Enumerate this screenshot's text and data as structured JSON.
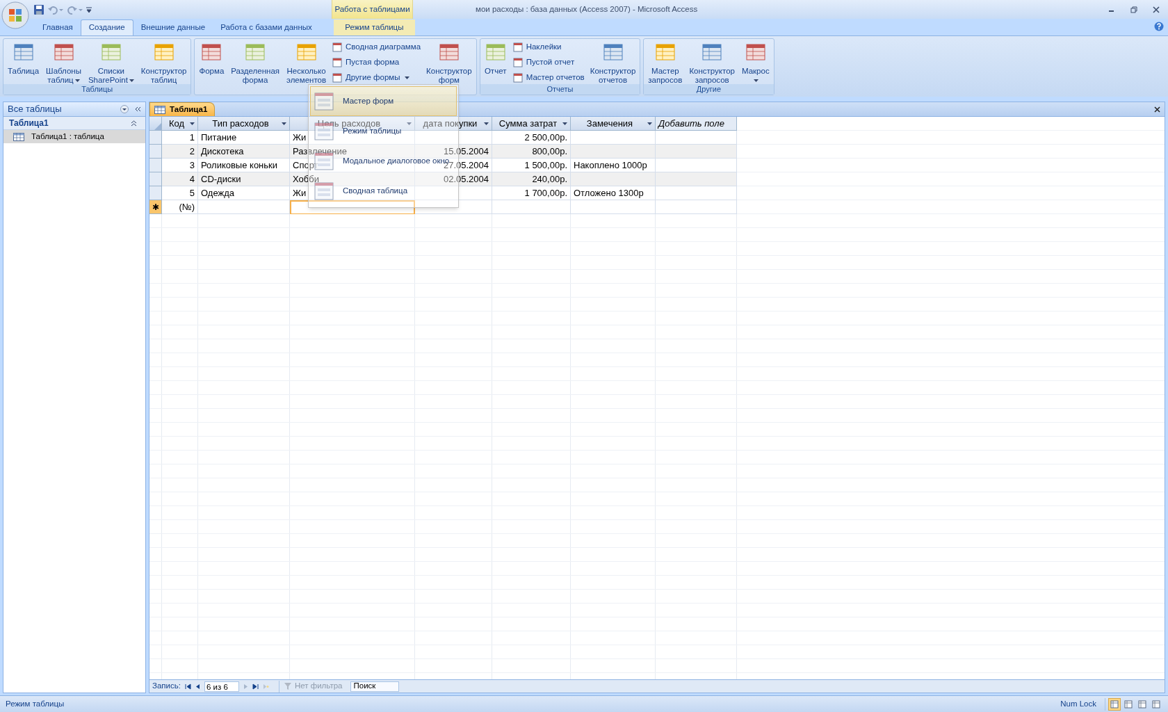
{
  "window": {
    "title": "мои расходы : база данных (Access 2007) - Microsoft Access"
  },
  "contextual_group": {
    "label": "Работа с таблицами"
  },
  "tabs": [
    {
      "label": "Главная",
      "selected": false,
      "contextual": false
    },
    {
      "label": "Создание",
      "selected": true,
      "contextual": false
    },
    {
      "label": "Внешние данные",
      "selected": false,
      "contextual": false
    },
    {
      "label": "Работа с базами данных",
      "selected": false,
      "contextual": false
    },
    {
      "label": "Режим таблицы",
      "selected": false,
      "contextual": true
    }
  ],
  "ribbon_groups": [
    {
      "label": "Таблицы",
      "items": [
        {
          "kind": "large",
          "lines": [
            "Таблица"
          ],
          "dropdown": false
        },
        {
          "kind": "large",
          "lines": [
            "Шаблоны",
            "таблиц"
          ],
          "dropdown": true
        },
        {
          "kind": "large",
          "lines": [
            "Списки",
            "SharePoint"
          ],
          "dropdown": true
        },
        {
          "kind": "large",
          "lines": [
            "Конструктор",
            "таблиц"
          ],
          "dropdown": false
        }
      ]
    },
    {
      "items": [
        {
          "kind": "large",
          "lines": [
            "Форма"
          ],
          "dropdown": false
        },
        {
          "kind": "large",
          "lines": [
            "Разделенная",
            "форма"
          ],
          "dropdown": false
        },
        {
          "kind": "large",
          "lines": [
            "Несколько",
            "элементов"
          ],
          "dropdown": false
        },
        {
          "kind": "small",
          "entries": [
            {
              "label": "Сводная диаграмма",
              "dropdown": false
            },
            {
              "label": "Пустая форма",
              "dropdown": false
            },
            {
              "label": "Другие формы",
              "dropdown": true
            }
          ]
        },
        {
          "kind": "large",
          "lines": [
            "Конструктор",
            "форм"
          ],
          "dropdown": false
        }
      ]
    },
    {
      "label": "Отчеты",
      "items": [
        {
          "kind": "large",
          "lines": [
            "Отчет"
          ],
          "dropdown": false
        },
        {
          "kind": "small",
          "entries": [
            {
              "label": "Наклейки",
              "dropdown": false
            },
            {
              "label": "Пустой отчет",
              "dropdown": false
            },
            {
              "label": "Мастер отчетов",
              "dropdown": false
            }
          ]
        },
        {
          "kind": "large",
          "lines": [
            "Конструктор",
            "отчетов"
          ],
          "dropdown": false
        }
      ]
    },
    {
      "label": "Другие",
      "items": [
        {
          "kind": "large",
          "lines": [
            "Мастер",
            "запросов"
          ],
          "dropdown": false
        },
        {
          "kind": "large",
          "lines": [
            "Конструктор",
            "запросов"
          ],
          "dropdown": false
        },
        {
          "kind": "large",
          "lines": [
            "Макрос"
          ],
          "dropdown": true
        }
      ]
    }
  ],
  "other_forms_menu": {
    "items": [
      {
        "label": "Мастер форм",
        "selected": true
      },
      {
        "label": "Режим таблицы",
        "selected": false
      },
      {
        "label": "Модальное диалоговое окно",
        "selected": false
      },
      {
        "label": "Сводная таблица",
        "selected": false
      }
    ]
  },
  "nav_pane": {
    "title": "Все таблицы",
    "group": {
      "label": "Таблица1",
      "expanded": true,
      "items": [
        {
          "label": "Таблица1 : таблица",
          "selected": true
        }
      ]
    }
  },
  "document_tabs": [
    {
      "label": "Таблица1",
      "selected": true
    }
  ],
  "datasheet": {
    "columns": [
      {
        "label": "Код",
        "kind": "field"
      },
      {
        "label": "Тип расходов",
        "kind": "field"
      },
      {
        "label": "Цель расходов",
        "kind": "field"
      },
      {
        "label": "дата покупки",
        "kind": "field"
      },
      {
        "label": "Сумма затрат",
        "kind": "field"
      },
      {
        "label": "Замечения",
        "kind": "field"
      },
      {
        "label": "Добавить поле",
        "kind": "add"
      }
    ],
    "rows": [
      [
        "1",
        "Питание",
        "Жи",
        "",
        "2 500,00р.",
        ""
      ],
      [
        "2",
        "Дискотека",
        "Развлечение",
        "15.05.2004",
        "800,00р.",
        ""
      ],
      [
        "3",
        "Роликовые коньки",
        "Спорт",
        "27.05.2004",
        "1 500,00р.",
        "Накоплено 1000р"
      ],
      [
        "4",
        "CD-диски",
        "Хобби",
        "02.05.2004",
        "240,00р.",
        ""
      ],
      [
        "5",
        "Одежда",
        "Жи",
        "",
        "1 700,00р.",
        "Отложено 1300р"
      ]
    ],
    "new_row": {
      "marker": "✱",
      "cells": [
        {
          "text": "(№)",
          "focused": false
        },
        {
          "text": "",
          "focused": false
        },
        {
          "text": "",
          "focused": true
        }
      ]
    }
  },
  "record_nav": {
    "label": "Запись:",
    "position": "6 из 6",
    "filter": "Нет фильтра",
    "search_placeholder": "Поиск"
  },
  "status_bar": {
    "text": "Режим таблицы",
    "num_lock": "Num Lock",
    "views": [
      {
        "selected": true
      },
      {
        "selected": false
      },
      {
        "selected": false
      },
      {
        "selected": false
      }
    ]
  }
}
